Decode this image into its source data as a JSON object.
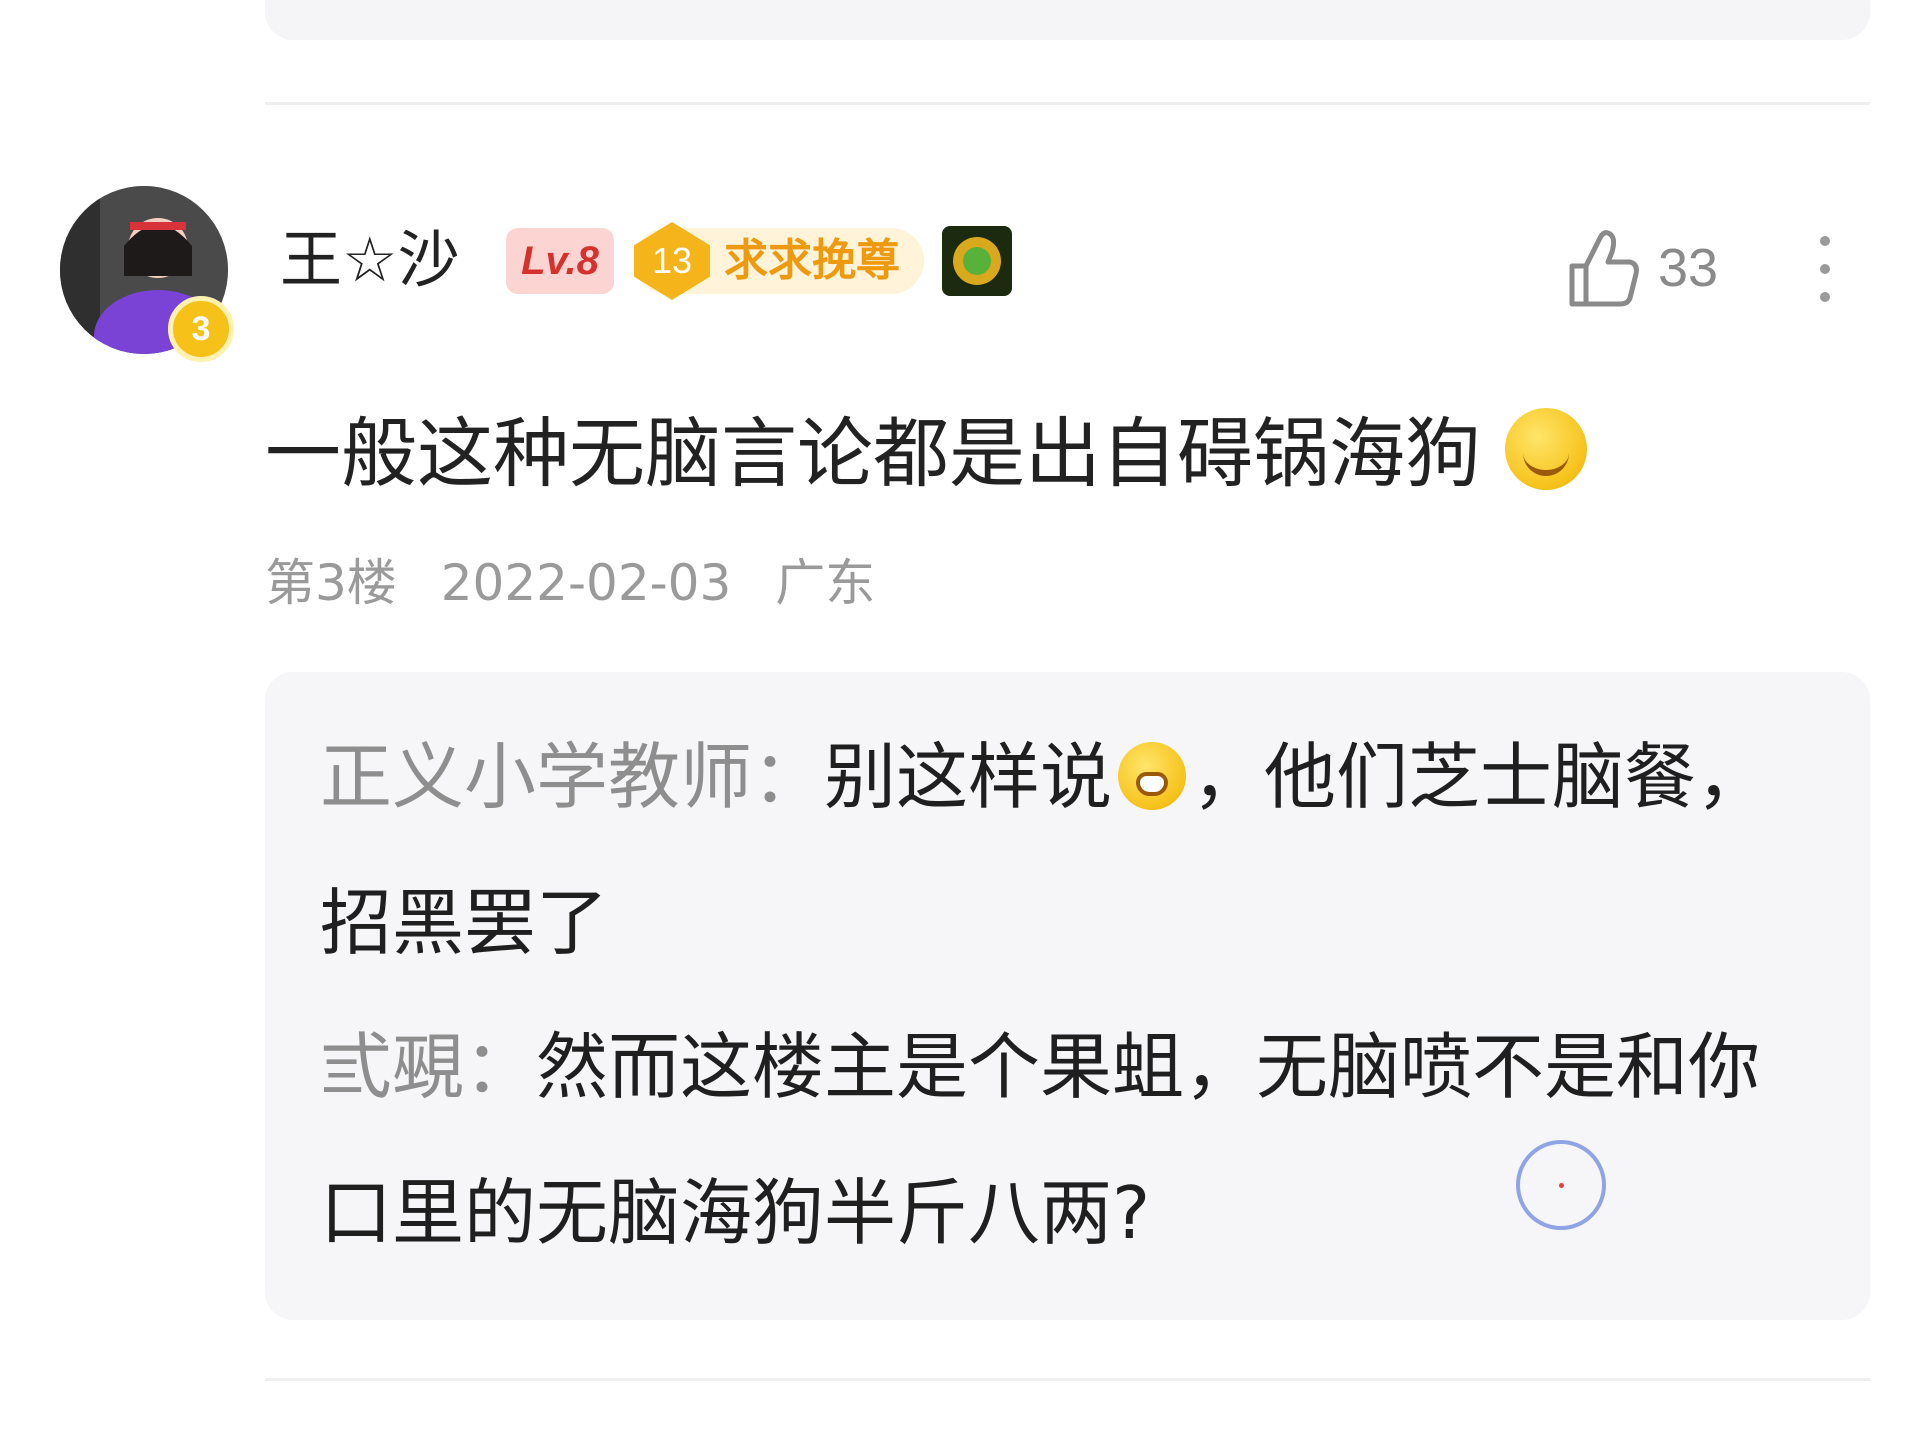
{
  "comment": {
    "author": {
      "name": "王☆沙",
      "level_badge": "Lv.8",
      "avatar_rank": "3",
      "fan_badge": {
        "level": "13",
        "title": "求求挽尊"
      },
      "medal_icon": "medal-icon"
    },
    "likes": "33",
    "text": "一般这种无脑言论都是出自碍锅海狗",
    "text_emoji": "smile-emoji",
    "floor": "第3楼",
    "date": "2022-02-03",
    "location": "广东"
  },
  "replies": [
    {
      "author": "正义小学教师：",
      "text_before_emoji": "别这样说",
      "emoji": "crying-emoji",
      "text_after_emoji": "，他们芝士脑餐，招黑罢了"
    },
    {
      "author": "弎覡：",
      "text": "然而这楼主是个果蛆，无脑喷不是和你口里的无脑海狗半斤八两?"
    }
  ],
  "colors": {
    "level_badge_bg": "#fcd5d2",
    "level_badge_text": "#d6312d",
    "fan_badge_text": "#ee9a10",
    "meta_text": "#9a9a9a",
    "reply_bg": "#f6f6f8"
  }
}
